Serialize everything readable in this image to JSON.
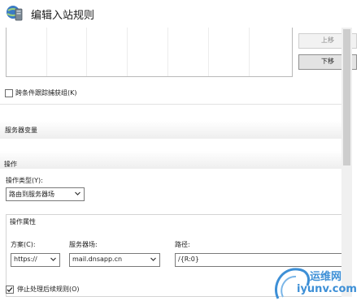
{
  "window": {
    "title": "编辑入站规则",
    "icon": "globe-server-icon"
  },
  "conditions": {
    "move_up_label": "上移",
    "move_down_label": "下移",
    "track_groups_label": "跨条件跟踪捕获组(K)",
    "track_groups_checked": false
  },
  "server_variables": {
    "title": "服务器变量"
  },
  "action": {
    "title": "操作",
    "type_label": "操作类型(Y):",
    "type_value": "路由到服务器场",
    "properties": {
      "title": "操作属性",
      "scheme_label": "方案(C):",
      "scheme_value": "https://",
      "farm_label": "服务器场:",
      "farm_value": "mail.dnsapp.cn",
      "path_label": "路径:",
      "path_value": "/{R:0}"
    },
    "stop_processing_label": "停止处理后续规则(O)",
    "stop_processing_checked": true
  },
  "watermark": {
    "line1": "运维网",
    "line2": "iyunv.com"
  },
  "colors": {
    "accent": "#3d8fd6",
    "border": "#7a7a7a"
  }
}
